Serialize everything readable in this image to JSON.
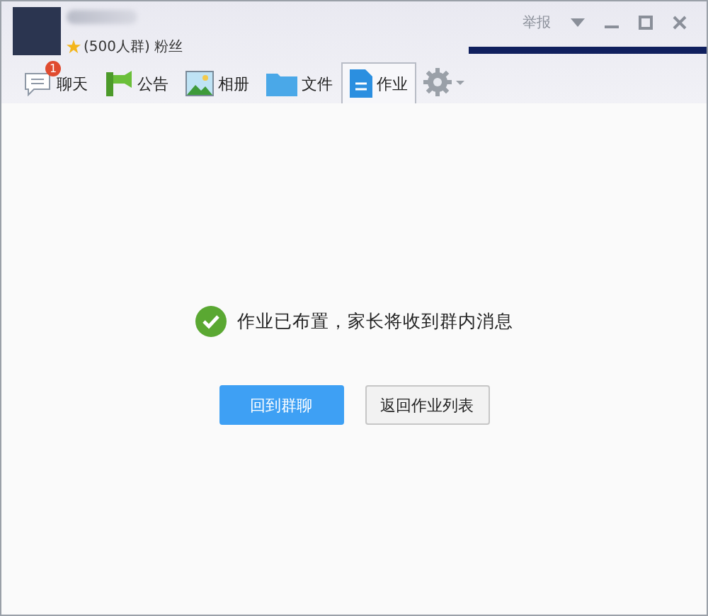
{
  "group": {
    "meta": "(500人群) 粉丝"
  },
  "title_bar": {
    "report": "举报"
  },
  "tabs": [
    {
      "label": "聊天",
      "kind": "chat",
      "badge": "1",
      "selected": false
    },
    {
      "label": "公告",
      "kind": "notice",
      "selected": false
    },
    {
      "label": "相册",
      "kind": "album",
      "selected": false
    },
    {
      "label": "文件",
      "kind": "files",
      "selected": false
    },
    {
      "label": "作业",
      "kind": "homework",
      "selected": true
    }
  ],
  "message": "作业已布置，家长将收到群内消息",
  "buttons": [
    {
      "label": "回到群聊",
      "kind": "primary"
    },
    {
      "label": "返回作业列表",
      "kind": "secondary"
    }
  ]
}
